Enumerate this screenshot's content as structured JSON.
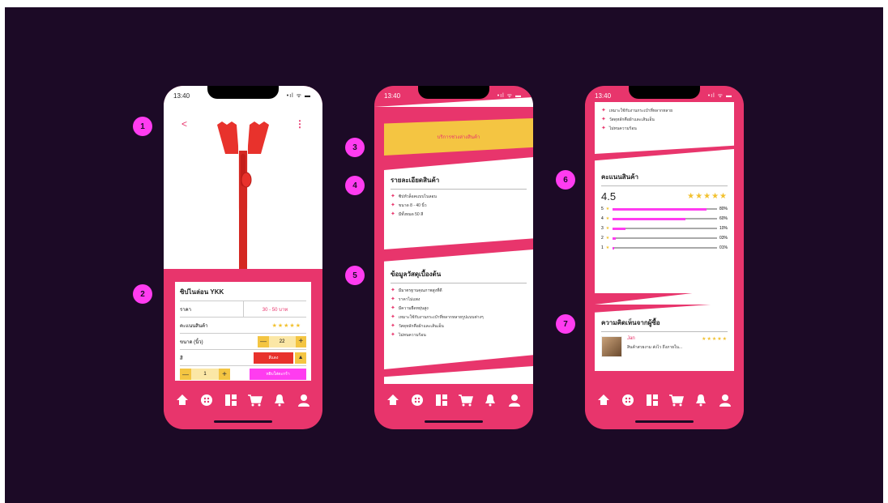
{
  "status_time": "13:40",
  "status_signal": "•ıl ᯤ ▬",
  "markers": [
    "1",
    "2",
    "3",
    "4",
    "5",
    "6",
    "7"
  ],
  "screen1": {
    "back": "<",
    "more": "⋮",
    "product_name": "ซิปไนล่อน YKK",
    "price_label": "ราคา",
    "price_value": "30 - 50 บาท",
    "rating_label": "คะแนนสินค้า",
    "rating_stars": "★★★★★",
    "size_label": "ขนาด (นิ้ว)",
    "size_value": "22",
    "color_label": "สี",
    "color_value": "สีแดง",
    "qty_value": "1",
    "add_to_cart": "หยิบใส่ตะกร้า",
    "minus": "—",
    "plus": "+",
    "dropdown": "▲"
  },
  "screen2": {
    "banner": "บริการช่วงล่างสินค้า",
    "details_title": "รายละเอียดสินค้า",
    "details_items": [
      "ซิปหัวล็อคแบบไนลอน",
      "ขนาด 8 - 40 นิ้ว",
      "มีทั้งหมด 50 สี"
    ],
    "basic_title": "ข้อมูลวัสดุเบื้องต้น",
    "basic_items": [
      "มีมาตรฐานคุณภาพสูงที่ดี",
      "ราคาไม่แพง",
      "มีความยืดหยุ่นสูง",
      "เหมาะใช้กับงานกระเป๋าที่หลากหลายรูปแบบต่างๆ",
      "วัสดุหลักคือผ้าและเส้นเอ็น",
      "ไม่ทนความร้อน"
    ]
  },
  "screen3": {
    "top_items": [
      "เหมาะใช้กับงานกระเป๋าที่หลากหลาย",
      "วัสดุหลักคือผ้าและเส้นเอ็น",
      "ไม่ทนความร้อน"
    ],
    "rating_title": "คะแนนสินค้า",
    "rating_avg": "4.5",
    "rating_stars": "★★★★★",
    "breakdown": [
      {
        "star": "5",
        "pct_label": "80%",
        "pct": 0.9
      },
      {
        "star": "4",
        "pct_label": "60%",
        "pct": 0.7
      },
      {
        "star": "3",
        "pct_label": "10%",
        "pct": 0.12
      },
      {
        "star": "2",
        "pct_label": "03%",
        "pct": 0.03
      },
      {
        "star": "1",
        "pct_label": "01%",
        "pct": 0.01
      }
    ],
    "reviews_title": "ความคิดเห็นจากผู้ซื้อ",
    "review_name": "Jan",
    "review_stars": "★★★★★",
    "review_text": "สินค้าสวยงาม ส่งไว ถึงภายใน..."
  },
  "colors": {
    "background": "#1c0a26",
    "accent": "#e8356c",
    "marker": "#ff3cf0",
    "star": "#f2c12e",
    "banner": "#f4c542",
    "zipper": "#e8322c"
  }
}
